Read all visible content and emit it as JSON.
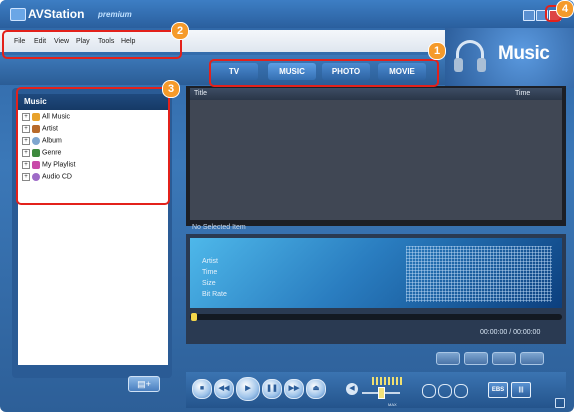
{
  "app": {
    "title": "AVStation",
    "edition": "premium",
    "section": "Music"
  },
  "menu": [
    "File",
    "Edit",
    "View",
    "Play",
    "Tools",
    "Help"
  ],
  "tabs": [
    {
      "label": "TV",
      "active": false
    },
    {
      "label": "MUSIC",
      "active": true
    },
    {
      "label": "PHOTO",
      "active": false
    },
    {
      "label": "MOVIE",
      "active": false
    }
  ],
  "library": {
    "title": "Music",
    "items": [
      {
        "label": "All Music",
        "icon": "music-note-icon",
        "color": "#e8a22b"
      },
      {
        "label": "Artist",
        "icon": "artist-icon",
        "color": "#b86a2a"
      },
      {
        "label": "Album",
        "icon": "album-disc-icon",
        "color": "#7fa6cf"
      },
      {
        "label": "Genre",
        "icon": "genre-icon",
        "color": "#3e8a3e"
      },
      {
        "label": "My Playlist",
        "icon": "playlist-icon",
        "color": "#c94aa9"
      },
      {
        "label": "Audio CD",
        "icon": "audio-cd-icon",
        "color": "#9e6bc7"
      }
    ]
  },
  "tracklist": {
    "col_title": "Title",
    "col_time": "Time",
    "status": "No Selected Item"
  },
  "info": {
    "labels": [
      "Artist",
      "Time",
      "Size",
      "Bit Rate"
    ],
    "time_readout": "00:00:00 / 00:00:00"
  },
  "volume": {
    "label": "MAX"
  },
  "effects": {
    "ebs": "EBS",
    "eq": "|||"
  },
  "callouts": [
    "1",
    "2",
    "3",
    "4"
  ],
  "colors": {
    "accent": "#2f66a6",
    "callout_border": "#e3211b",
    "callout_badge": "#f59a2a"
  }
}
